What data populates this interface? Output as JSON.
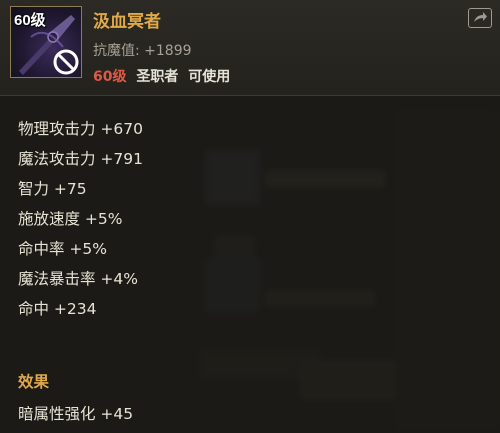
{
  "item": {
    "icon_level": "60级",
    "icon": "dark-blade-icon",
    "name": "汲血冥者",
    "resist_label": "抗魔值:",
    "resist_value": "+1899",
    "req_level": "60级",
    "req_class": "圣职者",
    "req_usable": "可使用",
    "share_icon": "share-icon"
  },
  "stats": [
    "物理攻击力 +670",
    "魔法攻击力 +791",
    "智力 +75",
    "施放速度 +5%",
    "命中率 +5%",
    "魔法暴击率 +4%",
    "命中 +234"
  ],
  "effect": {
    "title": "效果",
    "text": "暗属性强化 +45"
  },
  "colors": {
    "name": "#e0a94a",
    "req_level": "#e05a45",
    "stat_text": "#e6e2d4",
    "muted": "#a6a196"
  }
}
